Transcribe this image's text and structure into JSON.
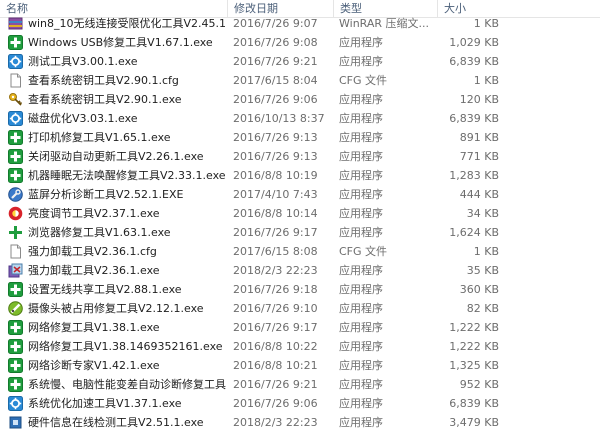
{
  "columns": {
    "name": "名称",
    "date": "修改日期",
    "type": "类型",
    "size": "大小"
  },
  "rows": [
    {
      "name": "win8_10无线连接受限优化工具V2.45.1.r...",
      "date": "2016/7/26 9:07",
      "type": "WinRAR 压缩文...",
      "size": "1 KB",
      "icon": "archive-icon"
    },
    {
      "name": "Windows USB修复工具V1.67.1.exe",
      "date": "2016/7/26 9:08",
      "type": "应用程序",
      "size": "1,029 KB",
      "icon": "green-cross-icon"
    },
    {
      "name": "测试工具V3.00.1.exe",
      "date": "2016/7/26 9:21",
      "type": "应用程序",
      "size": "6,839 KB",
      "icon": "gear-app-icon"
    },
    {
      "name": "查看系统密钥工具V2.90.1.cfg",
      "date": "2017/6/15 8:04",
      "type": "CFG 文件",
      "size": "1 KB",
      "icon": "file-icon"
    },
    {
      "name": "查看系统密钥工具V2.90.1.exe",
      "date": "2016/7/26 9:06",
      "type": "应用程序",
      "size": "120 KB",
      "icon": "key-icon"
    },
    {
      "name": "磁盘优化V3.03.1.exe",
      "date": "2016/10/13 8:37",
      "type": "应用程序",
      "size": "6,839 KB",
      "icon": "gear-app-icon"
    },
    {
      "name": "打印机修复工具V1.65.1.exe",
      "date": "2016/7/26 9:13",
      "type": "应用程序",
      "size": "891 KB",
      "icon": "green-cross-icon"
    },
    {
      "name": "关闭驱动自动更新工具V2.26.1.exe",
      "date": "2016/7/26 9:13",
      "type": "应用程序",
      "size": "771 KB",
      "icon": "green-cross-icon"
    },
    {
      "name": "机器睡眠无法唤醒修复工具V2.33.1.exe",
      "date": "2016/8/8 10:19",
      "type": "应用程序",
      "size": "1,283 KB",
      "icon": "green-cross-icon"
    },
    {
      "name": "蓝屏分析诊断工具V2.52.1.EXE",
      "date": "2017/4/10 7:43",
      "type": "应用程序",
      "size": "444 KB",
      "icon": "wrench-icon"
    },
    {
      "name": "亮度调节工具V2.37.1.exe",
      "date": "2016/8/8 10:14",
      "type": "应用程序",
      "size": "34 KB",
      "icon": "brightness-icon"
    },
    {
      "name": "浏览器修复工具V1.63.1.exe",
      "date": "2016/7/26 9:17",
      "type": "应用程序",
      "size": "1,624 KB",
      "icon": "plus-icon"
    },
    {
      "name": "强力卸载工具V2.36.1.cfg",
      "date": "2017/6/15 8:08",
      "type": "CFG 文件",
      "size": "1 KB",
      "icon": "file-icon"
    },
    {
      "name": "强力卸载工具V2.36.1.exe",
      "date": "2018/2/3 22:23",
      "type": "应用程序",
      "size": "35 KB",
      "icon": "uninstall-icon"
    },
    {
      "name": "设置无线共享工具V2.88.1.exe",
      "date": "2016/7/26 9:18",
      "type": "应用程序",
      "size": "360 KB",
      "icon": "green-cross-icon"
    },
    {
      "name": "摄像头被占用修复工具V2.12.1.exe",
      "date": "2016/7/26 9:10",
      "type": "应用程序",
      "size": "82 KB",
      "icon": "camera-icon"
    },
    {
      "name": "网络修复工具V1.38.1.exe",
      "date": "2016/7/26 9:17",
      "type": "应用程序",
      "size": "1,222 KB",
      "icon": "green-cross-icon"
    },
    {
      "name": "网络修复工具V1.38.1469352161.exe",
      "date": "2016/8/8 10:22",
      "type": "应用程序",
      "size": "1,222 KB",
      "icon": "green-cross-icon"
    },
    {
      "name": "网络诊断专家V1.42.1.exe",
      "date": "2016/8/8 10:21",
      "type": "应用程序",
      "size": "1,325 KB",
      "icon": "green-cross-icon"
    },
    {
      "name": "系统慢、电脑性能变差自动诊断修复工具...",
      "date": "2016/7/26 9:21",
      "type": "应用程序",
      "size": "952 KB",
      "icon": "green-cross-icon"
    },
    {
      "name": "系统优化加速工具V1.37.1.exe",
      "date": "2016/7/26 9:06",
      "type": "应用程序",
      "size": "6,839 KB",
      "icon": "gear-app-icon"
    },
    {
      "name": "硬件信息在线检测工具V2.51.1.exe",
      "date": "2018/2/3 22:23",
      "type": "应用程序",
      "size": "3,479 KB",
      "icon": "chip-icon"
    }
  ]
}
